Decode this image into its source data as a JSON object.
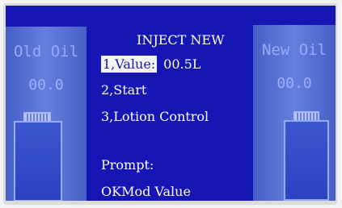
{
  "left_panel": {
    "title": "Old Oil",
    "value": "00.0"
  },
  "right_panel": {
    "title": "New Oil",
    "value": "00.0"
  },
  "menu": {
    "title": "INJECT NEW",
    "item1_label": "1,Value:",
    "item1_value": "00.5L",
    "item2_label": "2,Start",
    "item3_label": "3,Lotion Control",
    "prompt_label": "Prompt:",
    "prompt_message": "OKMod Value"
  },
  "colors": {
    "screen_bg": "#1616b4",
    "panel": "#6a86e0",
    "text": "#ffffff",
    "highlight_bg": "#f3f3f3"
  }
}
